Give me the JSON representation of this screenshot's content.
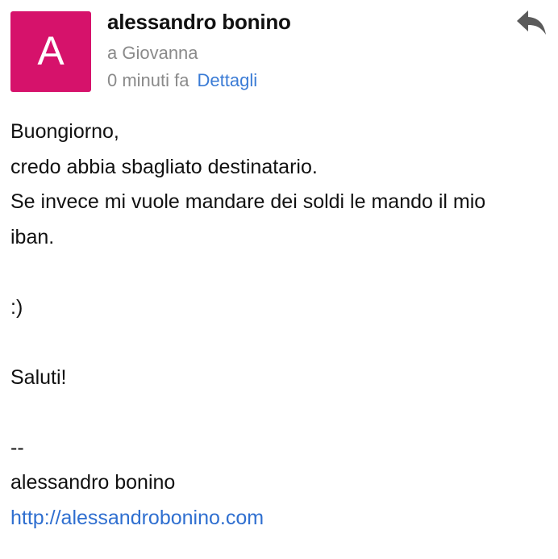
{
  "email": {
    "avatar": {
      "letter": "A",
      "color": "#d6126b"
    },
    "sender_name": "alessandro bonino",
    "recipient": "a Giovanna",
    "time": "0 minuti fa",
    "details_label": "Dettagli",
    "reply_icon": "reply-arrow-icon"
  },
  "body": {
    "greeting": "Buongiorno,",
    "line1": "credo abbia sbagliato destinatario.",
    "line2": "Se invece mi vuole mandare dei soldi le mando il mio",
    "line3": "iban.",
    "emoticon": ":)",
    "closing": "Saluti!",
    "sig_separator": "--",
    "sig_name": "alessandro bonino",
    "sig_link": "http://alessandrobonino.com"
  },
  "colors": {
    "accent_link": "#3a7bd5",
    "muted_text": "#8a8a8a"
  }
}
